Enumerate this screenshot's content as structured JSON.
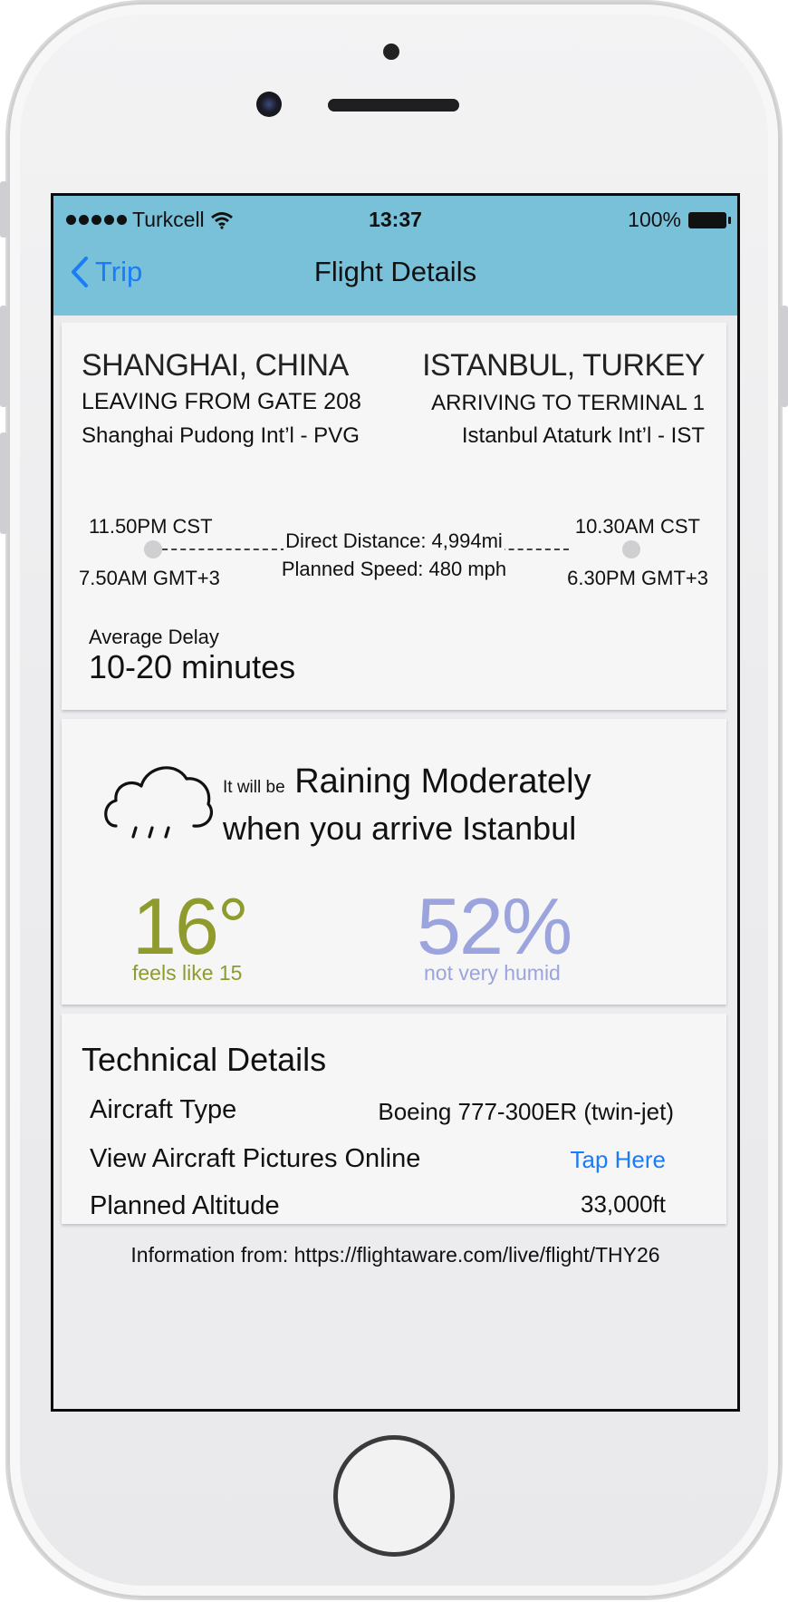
{
  "status_bar": {
    "carrier": "Turkcell",
    "time": "13:37",
    "battery": "100%"
  },
  "nav": {
    "back_label": "Trip",
    "title": "Flight Details"
  },
  "flight": {
    "origin_city": "SHANGHAI, CHINA",
    "origin_gate": "LEAVING FROM GATE 208",
    "origin_airport": "Shanghai Pudong Int’l - PVG",
    "dest_city": "ISTANBUL, TURKEY",
    "dest_terminal": "ARRIVING TO TERMINAL 1",
    "dest_airport": "Istanbul Ataturk Int’l - IST",
    "depart_local": "11.50PM CST",
    "depart_gmt": "7.50AM GMT+3",
    "arrive_local": "10.30AM CST",
    "arrive_gmt": "6.30PM GMT+3",
    "distance": "Direct Distance: 4,994mi",
    "speed": "Planned Speed: 480 mph",
    "delay_label": "Average Delay",
    "delay_value": "10-20 minutes"
  },
  "weather": {
    "prefix": "It will be",
    "condition": "Raining Moderately",
    "line2": "when you arrive Istanbul",
    "temperature": "16°",
    "feels_like": "feels like 15",
    "humidity": "52%",
    "humidity_note": "not very humid",
    "temp_color": "#8f9b2c",
    "humidity_color": "#9ba4dc",
    "icon": "cloud-rain-icon"
  },
  "technical": {
    "title": "Technical Details",
    "rows": [
      {
        "label": "Aircraft Type",
        "value": "Boeing 777-300ER (twin-jet)"
      },
      {
        "label": "View Aircraft Pictures Online",
        "value": "Tap Here"
      },
      {
        "label": "Planned Altitude",
        "value": "33,000ft"
      }
    ],
    "link_color": "#1a7cf6"
  },
  "footer": {
    "source": "Information from: https://flightaware.com/live/flight/THY26"
  }
}
